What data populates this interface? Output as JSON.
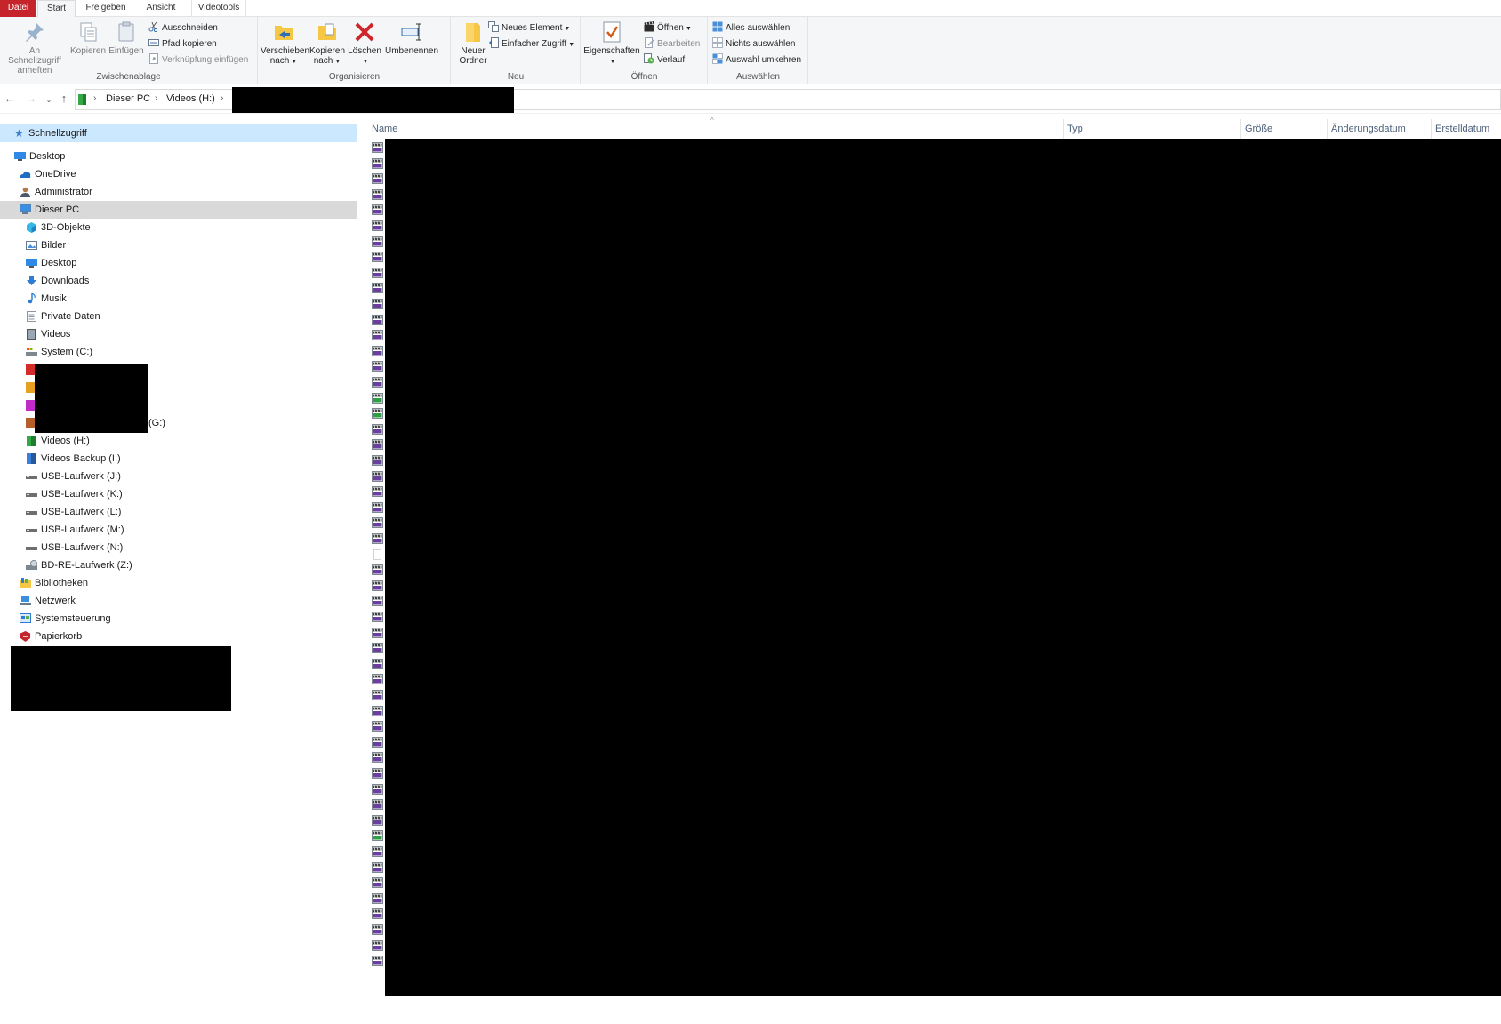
{
  "tabs": {
    "file": "Datei",
    "start": "Start",
    "share": "Freigeben",
    "view": "Ansicht",
    "videotools": "Videotools"
  },
  "ribbon": {
    "clipboard": {
      "label": "Zwischenablage",
      "pin": "An Schnellzugriff anheften",
      "pin_line1": "An Schnellzugriff",
      "pin_line2": "anheften",
      "copy": "Kopieren",
      "paste": "Einfügen",
      "cut": "Ausschneiden",
      "copy_path": "Pfad kopieren",
      "paste_shortcut": "Verknüpfung einfügen"
    },
    "organize": {
      "label": "Organisieren",
      "move_to_line1": "Verschieben",
      "move_to_line2": "nach",
      "copy_to_line1": "Kopieren",
      "copy_to_line2": "nach",
      "delete": "Löschen",
      "rename": "Umbenennen"
    },
    "new": {
      "label": "Neu",
      "new_folder_line1": "Neuer",
      "new_folder_line2": "Ordner",
      "new_item": "Neues Element",
      "easy_access": "Einfacher Zugriff"
    },
    "open": {
      "label": "Öffnen",
      "properties": "Eigenschaften",
      "open": "Öffnen",
      "edit": "Bearbeiten",
      "history": "Verlauf"
    },
    "select": {
      "label": "Auswählen",
      "select_all": "Alles auswählen",
      "select_none": "Nichts auswählen",
      "invert": "Auswahl umkehren"
    }
  },
  "address": {
    "crumbs": [
      "Dieser PC",
      "Videos (H:)"
    ]
  },
  "navpane": {
    "quick_access": "Schnellzugriff",
    "items": [
      {
        "label": "Desktop",
        "icon": "desktop-icon",
        "indent": 0
      },
      {
        "label": "OneDrive",
        "icon": "onedrive-icon",
        "indent": 1
      },
      {
        "label": "Administrator",
        "icon": "user-icon",
        "indent": 1
      },
      {
        "label": "Dieser PC",
        "icon": "pc-icon",
        "indent": 1
      },
      {
        "label": "3D-Objekte",
        "icon": "3d-objects-icon",
        "indent": 2
      },
      {
        "label": "Bilder",
        "icon": "pictures-icon",
        "indent": 2
      },
      {
        "label": "Desktop",
        "icon": "desktop-icon",
        "indent": 2
      },
      {
        "label": "Downloads",
        "icon": "downloads-icon",
        "indent": 2
      },
      {
        "label": "Musik",
        "icon": "music-icon",
        "indent": 2
      },
      {
        "label": "Private Daten",
        "icon": "document-icon",
        "indent": 2
      },
      {
        "label": "Videos",
        "icon": "videos-icon",
        "indent": 2
      },
      {
        "label": "System (C:)",
        "icon": "system-drive-icon",
        "indent": 2
      }
    ],
    "drive_g_suffix": "(G:)",
    "items_after": [
      {
        "label": "Videos (H:)",
        "icon": "drive-green-icon",
        "indent": 2
      },
      {
        "label": "Videos Backup (I:)",
        "icon": "drive-blue-icon",
        "indent": 2
      },
      {
        "label": "USB-Laufwerk (J:)",
        "icon": "usb-drive-icon",
        "indent": 2
      },
      {
        "label": "USB-Laufwerk (K:)",
        "icon": "usb-drive-icon",
        "indent": 2
      },
      {
        "label": "USB-Laufwerk (L:)",
        "icon": "usb-drive-icon",
        "indent": 2
      },
      {
        "label": "USB-Laufwerk (M:)",
        "icon": "usb-drive-icon",
        "indent": 2
      },
      {
        "label": "USB-Laufwerk (N:)",
        "icon": "usb-drive-icon",
        "indent": 2
      },
      {
        "label": "BD-RE-Laufwerk (Z:)",
        "icon": "optical-drive-icon",
        "indent": 2
      },
      {
        "label": "Bibliotheken",
        "icon": "libraries-icon",
        "indent": 1
      },
      {
        "label": "Netzwerk",
        "icon": "network-icon",
        "indent": 1
      },
      {
        "label": "Systemsteuerung",
        "icon": "control-panel-icon",
        "indent": 1
      },
      {
        "label": "Papierkorb",
        "icon": "recycle-bin-icon",
        "indent": 1
      }
    ]
  },
  "filelist": {
    "columns": {
      "name": "Name",
      "type": "Typ",
      "size": "Größe",
      "modified": "Änderungsdatum",
      "created": "Erstelldatum"
    },
    "row_icons": [
      "video",
      "video",
      "video",
      "video",
      "video",
      "video",
      "video",
      "video",
      "video",
      "video",
      "video",
      "video",
      "video",
      "video",
      "video",
      "video",
      "green",
      "green",
      "video",
      "video",
      "video",
      "video",
      "video",
      "video",
      "video",
      "video",
      "blank",
      "video",
      "video",
      "video",
      "video",
      "video",
      "video",
      "video",
      "video",
      "video",
      "video",
      "video",
      "video",
      "video",
      "video",
      "video",
      "video",
      "video",
      "green",
      "video",
      "video",
      "video",
      "video",
      "video",
      "video",
      "video",
      "video"
    ]
  },
  "colors": {
    "file_tab": "#c5242b",
    "quick_access_highlight": "#cce8ff",
    "selected_row": "#d9d9d9",
    "column_header_text": "#4c607a"
  }
}
